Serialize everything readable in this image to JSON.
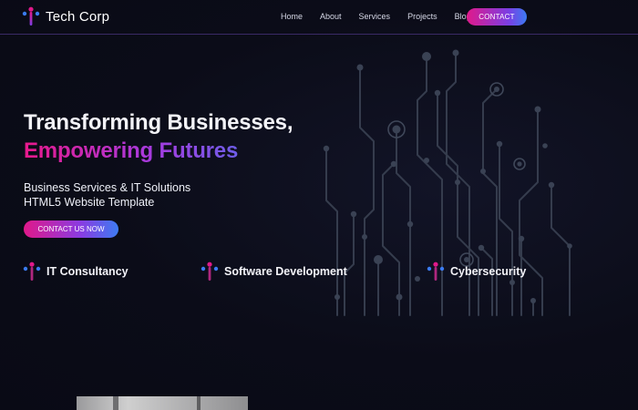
{
  "brand": {
    "name": "Tech Corp",
    "logo_icon": "tech-corp-logo-icon"
  },
  "nav": {
    "links": [
      "Home",
      "About",
      "Services",
      "Projects",
      "Blog"
    ],
    "cta": "CONTACT"
  },
  "hero": {
    "title_line1": "Transforming Businesses,",
    "title_line2": "Empowering Futures",
    "subtitle_line1": "Business Services & IT Solutions",
    "subtitle_line2": "HTML5 Website Template",
    "button": "CONTACT US NOW"
  },
  "services": [
    {
      "label": "IT Consultancy",
      "icon": "tech-corp-logo-icon"
    },
    {
      "label": "Software Development",
      "icon": "tech-corp-logo-icon"
    },
    {
      "label": "Cybersecurity",
      "icon": "tech-corp-logo-icon"
    }
  ],
  "colors": {
    "background": "#0b0c18",
    "accent_pink": "#e0198a",
    "accent_purple": "#7b3fe4",
    "accent_blue": "#3b7bf2",
    "circuit_line": "#3a4152"
  }
}
